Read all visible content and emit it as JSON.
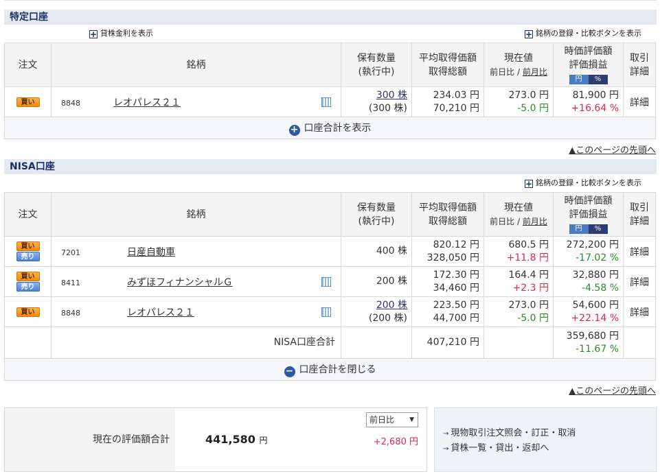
{
  "tokutei": {
    "title": "特定口座",
    "lending_link": "貸株金利を表示",
    "register_link": "銘柄の登録・比較ボタンを表示",
    "rows": [
      {
        "order": [
          "買い"
        ],
        "code": "8848",
        "name": "レオパレス２１",
        "calc": true,
        "qty": "300 株",
        "qty_pending": "(300 株)",
        "avg": "234.03 円",
        "cost": "70,210 円",
        "price": "273.0 円",
        "change": "-5.0 円",
        "change_dir": "down",
        "value": "81,900 円",
        "pl": "+16.64 %",
        "pl_dir": "up",
        "detail": "詳細"
      }
    ],
    "toggle_label": "口座合計を表示",
    "toggle_symbol": "+"
  },
  "nisa": {
    "title": "NISA口座",
    "register_link": "銘柄の登録・比較ボタンを表示",
    "rows": [
      {
        "order": [
          "買い",
          "売り"
        ],
        "code": "7201",
        "name": "日産自動車",
        "calc": false,
        "qty": "400 株",
        "qty_pending": "",
        "avg": "820.12 円",
        "cost": "328,050 円",
        "price": "680.5 円",
        "change": "+11.8 円",
        "change_dir": "up",
        "value": "272,200 円",
        "pl": "-17.02 %",
        "pl_dir": "down",
        "detail": "詳細"
      },
      {
        "order": [
          "買い",
          "売り"
        ],
        "code": "8411",
        "name": "みずほフィナンシャルＧ",
        "calc": true,
        "qty": "200 株",
        "qty_pending": "",
        "avg": "172.30 円",
        "cost": "34,460 円",
        "price": "164.4 円",
        "change": "+2.3 円",
        "change_dir": "up",
        "value": "32,880 円",
        "pl": "-4.58 %",
        "pl_dir": "down",
        "detail": "詳細"
      },
      {
        "order": [
          "買い"
        ],
        "code": "8848",
        "name": "レオパレス２１",
        "calc": true,
        "qty": "200 株",
        "qty_pending": "(200 株)",
        "avg": "223.50 円",
        "cost": "44,700 円",
        "price": "273.0 円",
        "change": "-5.0 円",
        "change_dir": "down",
        "value": "54,600 円",
        "pl": "+22.14 %",
        "pl_dir": "up",
        "detail": "詳細"
      }
    ],
    "total": {
      "label": "NISA口座合計",
      "cost": "407,210 円",
      "value": "359,680 円",
      "pl": "-11.67 %"
    },
    "toggle_label": "口座合計を閉じる",
    "toggle_symbol": "−"
  },
  "headers": {
    "order": "注文",
    "name": "銘柄",
    "qty1": "保有数量",
    "qty2": "(執行中)",
    "avg1": "平均取得価額",
    "avg2": "取得総額",
    "price1": "現在値",
    "price_day": "前日比",
    "price_sep": " / ",
    "price_month": "前月比",
    "val1": "時価評価額",
    "val2": "評価損益",
    "tog_yen": "円",
    "tog_pct": "%",
    "trade1": "取引",
    "trade2": "詳細"
  },
  "page_top": "▲このページの先頭へ",
  "summary": {
    "label": "現在の評価額合計",
    "total": "441,580",
    "yen": "円",
    "select_value": "前日比",
    "change": "+2,680 円"
  },
  "links": [
    "現物取引注文照会・訂正・取消",
    "貸株一覧・貸出・返却へ"
  ],
  "colors": {
    "up": "#e0284c",
    "down": "#2a8c2a",
    "header_bg": "#e5eaf1",
    "accent": "#2d57a8"
  }
}
